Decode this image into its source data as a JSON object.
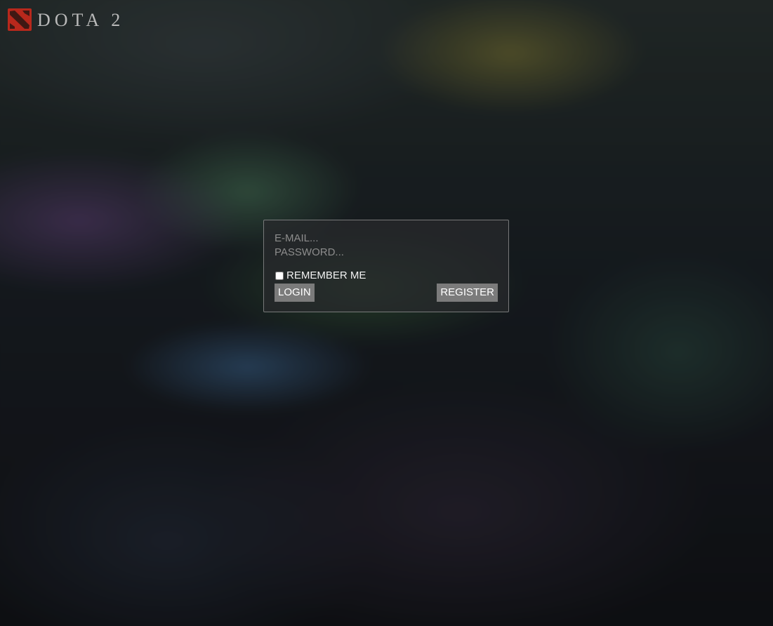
{
  "brand": {
    "logo_icon": "dota2-logo-icon",
    "logo_text": "DOTA 2"
  },
  "login": {
    "email_placeholder": "E-MAIL...",
    "email_value": "",
    "password_placeholder": "PASSWORD...",
    "password_value": "",
    "remember_label": "REMEMBER ME",
    "remember_checked": false,
    "login_label": "LOGIN",
    "register_label": "REGISTER"
  },
  "colors": {
    "logo_red": "#b8281c",
    "button_gray": "#7b7b7b",
    "box_border": "#bebebe"
  }
}
